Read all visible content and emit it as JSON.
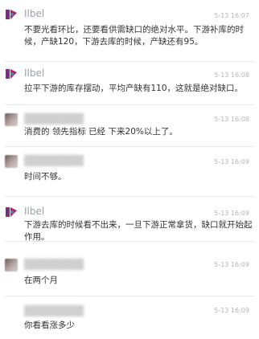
{
  "messages": [
    {
      "user": "Ilbel",
      "time": "5-13 16:07",
      "text": "不要光看环比，还要看供需缺口的绝对水平。下游补库的时候，产缺120，下游去库的时候，产缺还有95。",
      "avatar": "brand-logo-icon"
    },
    {
      "user": "Ilbel",
      "time": "5-13 16:08",
      "text": "拉平下游的库存摆动，平均产缺有110，这就是绝对缺口。",
      "avatar": "brand-logo-icon"
    },
    {
      "user": "",
      "time": "5-13 16:08",
      "text": "消费的 领先指标 已经 下来20%以上了。",
      "avatar": "user-avatar"
    },
    {
      "user": "",
      "time": "5-13 16:09",
      "text": "时间不够。",
      "avatar": "user-avatar"
    },
    {
      "user": "Ilbel",
      "time": "5-13 16:09",
      "text": "下游去库的时候看不出来，一旦下游正常拿货，缺口就开始起作用。",
      "avatar": "brand-logo-icon"
    },
    {
      "user": "",
      "time": "5-13 16:09",
      "text": "在两个月",
      "avatar": "user-avatar"
    },
    {
      "user": "",
      "time": "5-13 16:09",
      "text": "你看看涨多少",
      "avatar": "user-avatar"
    }
  ]
}
